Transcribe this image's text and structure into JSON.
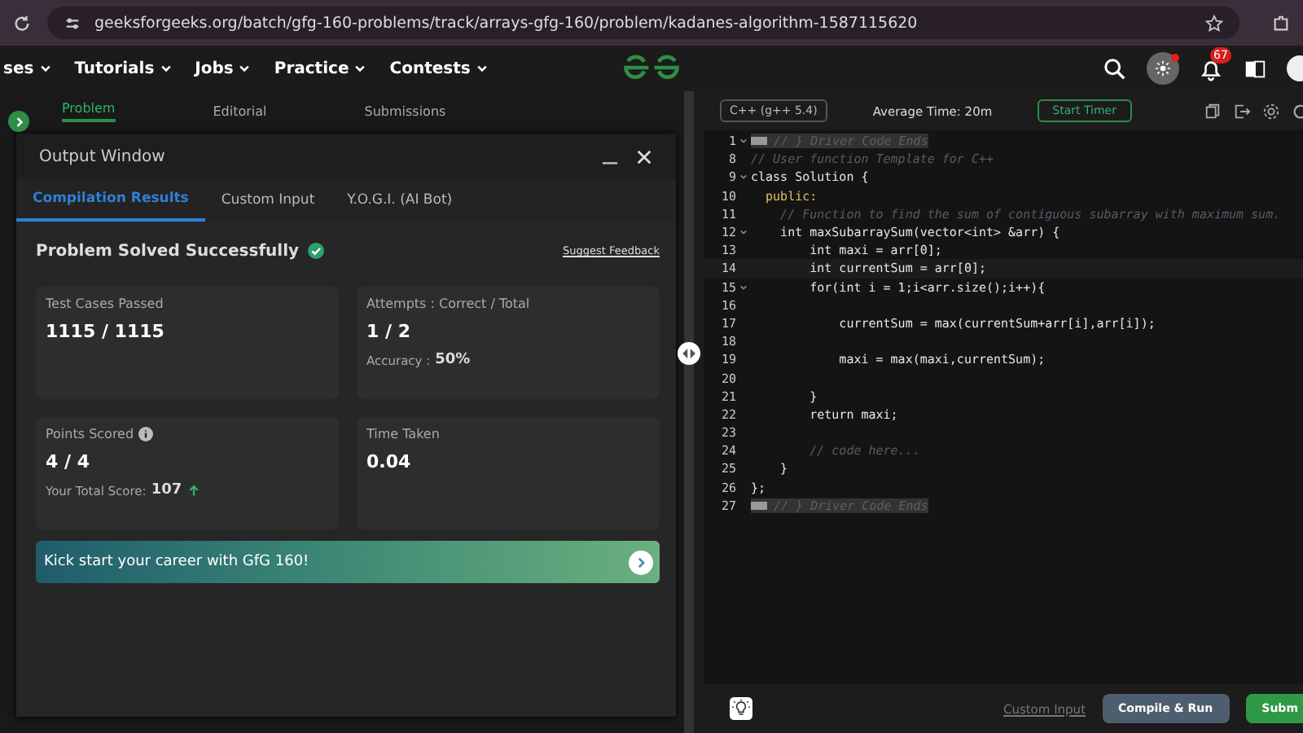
{
  "browser": {
    "url": "geeksforgeeks.org/batch/gfg-160-problems/track/arrays-gfg-160/problem/kadanes-algorithm-1587115620"
  },
  "nav": {
    "items": [
      {
        "label": "ses"
      },
      {
        "label": "Tutorials"
      },
      {
        "label": "Jobs"
      },
      {
        "label": "Practice"
      },
      {
        "label": "Contests"
      }
    ],
    "notifications": "67"
  },
  "problem_tabs": [
    {
      "label": "Problem",
      "selected": true
    },
    {
      "label": "Editorial",
      "selected": false
    },
    {
      "label": "Submissions",
      "selected": false
    }
  ],
  "output_window": {
    "title": "Output Window",
    "tabs": [
      {
        "label": "Compilation Results",
        "selected": true
      },
      {
        "label": "Custom Input",
        "selected": false
      },
      {
        "label": "Y.O.G.I. (AI Bot)",
        "selected": false
      }
    ],
    "status": "Problem Solved Successfully",
    "feedback_link": "Suggest Feedback",
    "cards": [
      {
        "kind": "plain",
        "label": "Test Cases Passed",
        "value": "1115 / 1115"
      },
      {
        "kind": "accuracy",
        "label": "Attempts : Correct / Total",
        "value": "1 / 2",
        "note_label": "Accuracy :",
        "note_value": "50%"
      },
      {
        "kind": "score",
        "label": "Points Scored",
        "value": "4 / 4",
        "note_label": "Your Total Score:",
        "note_value": "107"
      },
      {
        "kind": "plain",
        "label": "Time Taken",
        "value": "0.04"
      }
    ],
    "banner": "Kick start your career with GfG 160!"
  },
  "editor": {
    "language": "C++ (g++ 5.4)",
    "average_time": "Average Time: 20m",
    "timer_button": "Start Timer",
    "lines": [
      {
        "number": "1",
        "fold": true,
        "kind": "collapsed",
        "text": "// } Driver Code Ends"
      },
      {
        "number": "8",
        "fold": false,
        "kind": "comment",
        "text": "// User function Template for C++"
      },
      {
        "number": "9",
        "fold": true,
        "kind": "code",
        "text": "class Solution {"
      },
      {
        "number": "10",
        "fold": false,
        "kind": "keyword",
        "text": "  public:"
      },
      {
        "number": "11",
        "fold": false,
        "kind": "comment",
        "text": "    // Function to find the sum of contiguous subarray with maximum sum."
      },
      {
        "number": "12",
        "fold": true,
        "kind": "code",
        "text": "    int maxSubarraySum(vector<int> &arr) {"
      },
      {
        "number": "13",
        "fold": false,
        "kind": "code",
        "text": "        int maxi = arr[0];"
      },
      {
        "number": "14",
        "fold": false,
        "kind": "code",
        "text": "        int currentSum = arr[0];"
      },
      {
        "number": "15",
        "fold": true,
        "kind": "code",
        "text": "        for(int i = 1;i<arr.size();i++){"
      },
      {
        "number": "16",
        "fold": false,
        "kind": "code"
      },
      {
        "number": "17",
        "fold": false,
        "kind": "code",
        "text": "            currentSum = max(currentSum+arr[i],arr[i]);"
      },
      {
        "number": "18",
        "fold": false,
        "kind": "code"
      },
      {
        "number": "19",
        "fold": false,
        "kind": "code",
        "text": "            maxi = max(maxi,currentSum);"
      },
      {
        "number": "20",
        "fold": false,
        "kind": "code"
      },
      {
        "number": "21",
        "fold": false,
        "kind": "code",
        "text": "        }"
      },
      {
        "number": "22",
        "fold": false,
        "kind": "code",
        "text": "        return maxi;"
      },
      {
        "number": "23",
        "fold": false,
        "kind": "code"
      },
      {
        "number": "24",
        "fold": false,
        "kind": "comment",
        "text": "        // code here..."
      },
      {
        "number": "25",
        "fold": false,
        "kind": "code",
        "text": "    }"
      },
      {
        "number": "26",
        "fold": false,
        "kind": "code",
        "text": "};"
      },
      {
        "number": "27",
        "fold": false,
        "kind": "collapsed",
        "text": "// } Driver Code Ends"
      }
    ],
    "custom_input": "Custom Input",
    "compile_button": "Compile & Run",
    "submit_button": "Subm"
  }
}
